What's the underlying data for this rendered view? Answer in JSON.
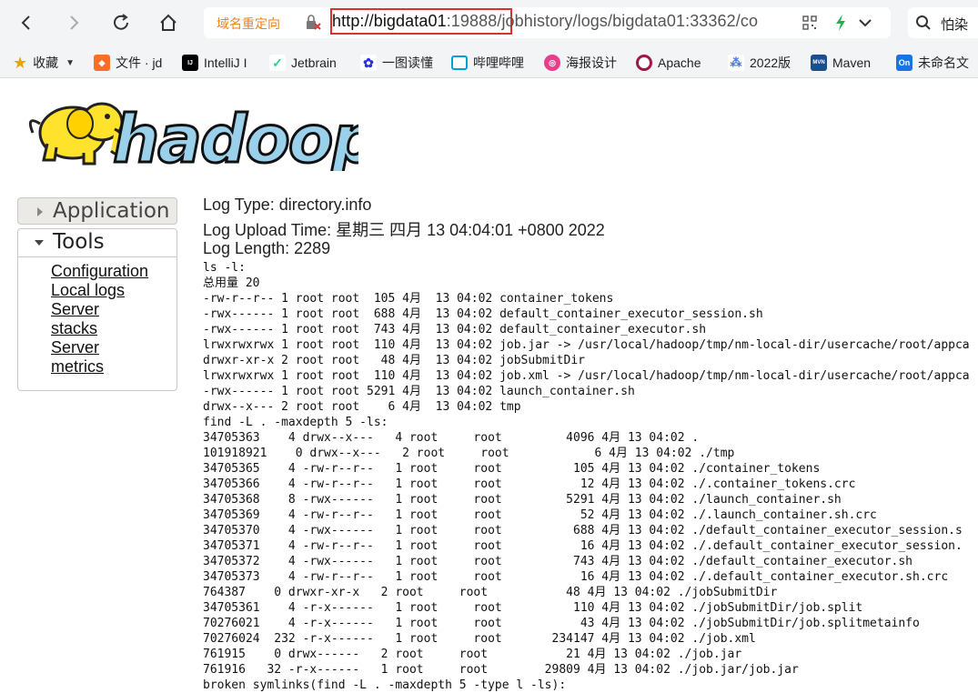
{
  "browser": {
    "redirect_label": "域名重定向",
    "url_host": "http://bigdata01",
    "url_port": ":19888",
    "url_path": "/jobhistory/logs/bigdata01:33362/co",
    "search_text": "怕染",
    "bookmarks": [
      {
        "label": "收藏",
        "icon": "star-icon"
      },
      {
        "label": "文件 · jd",
        "icon": "gitlab-icon"
      },
      {
        "label": "IntelliJ I",
        "icon": "intellij-icon"
      },
      {
        "label": "Jetbrain",
        "icon": "jetbrains-icon"
      },
      {
        "label": "一图读懂",
        "icon": "baidu-icon"
      },
      {
        "label": "哔哩哔哩",
        "icon": "bilibili-icon"
      },
      {
        "label": "海报设计",
        "icon": "poster-icon"
      },
      {
        "label": "Apache",
        "icon": "apache-icon"
      },
      {
        "label": "2022版",
        "icon": "dots-icon"
      },
      {
        "label": "Maven",
        "icon": "maven-icon"
      },
      {
        "label": "未命名文",
        "icon": "on-icon"
      }
    ]
  },
  "sidebar": {
    "application_label": "Application",
    "tools_label": "Tools",
    "links": [
      "Configuration",
      "Local logs",
      "Server",
      "stacks",
      "Server",
      "metrics"
    ]
  },
  "log": {
    "type": "Log Type: directory.info",
    "upload_time": "Log Upload Time: 星期三 四月 13 04:04:01 +0800 2022",
    "length": "Log Length: 2289",
    "lines": [
      "ls -l:",
      "总用量 20",
      "-rw-r--r-- 1 root root  105 4月  13 04:02 container_tokens",
      "-rwx------ 1 root root  688 4月  13 04:02 default_container_executor_session.sh",
      "-rwx------ 1 root root  743 4月  13 04:02 default_container_executor.sh",
      "lrwxrwxrwx 1 root root  110 4月  13 04:02 job.jar -> /usr/local/hadoop/tmp/nm-local-dir/usercache/root/appca",
      "drwxr-xr-x 2 root root   48 4月  13 04:02 jobSubmitDir",
      "lrwxrwxrwx 1 root root  110 4月  13 04:02 job.xml -> /usr/local/hadoop/tmp/nm-local-dir/usercache/root/appca",
      "-rwx------ 1 root root 5291 4月  13 04:02 launch_container.sh",
      "drwx--x--- 2 root root    6 4月  13 04:02 tmp",
      "find -L . -maxdepth 5 -ls:",
      "34705363    4 drwx--x---   4 root     root         4096 4月 13 04:02 .",
      "101918921    0 drwx--x---   2 root     root            6 4月 13 04:02 ./tmp",
      "34705365    4 -rw-r--r--   1 root     root          105 4月 13 04:02 ./container_tokens",
      "34705366    4 -rw-r--r--   1 root     root           12 4月 13 04:02 ./.container_tokens.crc",
      "34705368    8 -rwx------   1 root     root         5291 4月 13 04:02 ./launch_container.sh",
      "34705369    4 -rw-r--r--   1 root     root           52 4月 13 04:02 ./.launch_container.sh.crc",
      "34705370    4 -rwx------   1 root     root          688 4月 13 04:02 ./default_container_executor_session.s",
      "34705371    4 -rw-r--r--   1 root     root           16 4月 13 04:02 ./.default_container_executor_session.",
      "34705372    4 -rwx------   1 root     root          743 4月 13 04:02 ./default_container_executor.sh",
      "34705373    4 -rw-r--r--   1 root     root           16 4月 13 04:02 ./.default_container_executor.sh.crc",
      "764387    0 drwxr-xr-x   2 root     root           48 4月 13 04:02 ./jobSubmitDir",
      "34705361    4 -r-x------   1 root     root          110 4月 13 04:02 ./jobSubmitDir/job.split",
      "70276021    4 -r-x------   1 root     root           43 4月 13 04:02 ./jobSubmitDir/job.splitmetainfo",
      "70276024  232 -r-x------   1 root     root       234147 4月 13 04:02 ./job.xml",
      "761915    0 drwx------   2 root     root           21 4月 13 04:02 ./job.jar",
      "761916   32 -r-x------   1 root     root        29809 4月 13 04:02 ./job.jar/job.jar",
      "broken symlinks(find -L . -maxdepth 5 -type l -ls):"
    ]
  }
}
